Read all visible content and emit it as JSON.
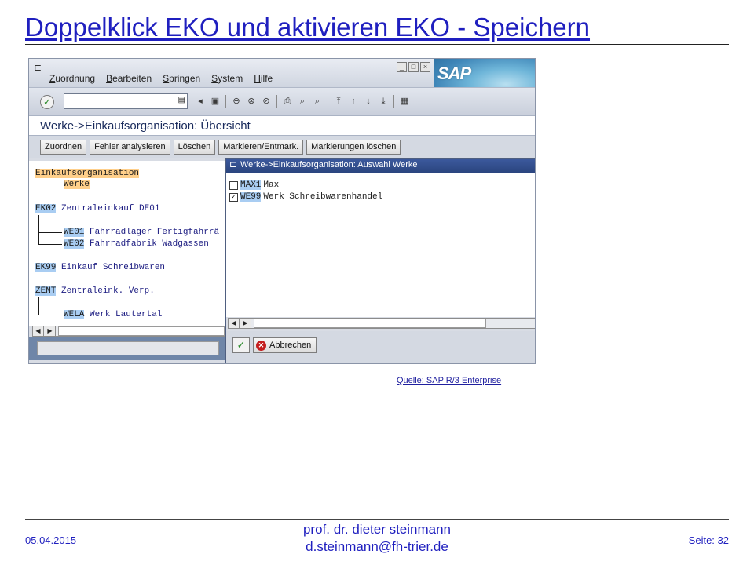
{
  "slide": {
    "title": "Doppelklick EKO und aktivieren EKO - Speichern",
    "source": "Quelle: SAP R/3 Enterprise",
    "footer": {
      "date": "05.04.2015",
      "author_line1": "prof. dr. dieter steinmann",
      "author_line2": "d.steinmann@fh-trier.de",
      "page": "Seite: 32"
    }
  },
  "sap": {
    "logo": "SAP",
    "menu": [
      {
        "first": "Z",
        "rest": "uordnung"
      },
      {
        "first": "B",
        "rest": "earbeiten"
      },
      {
        "first": "S",
        "rest": "pringen"
      },
      {
        "first": "S",
        "rest": "ystem"
      },
      {
        "first": "H",
        "rest": "ilfe"
      }
    ],
    "screen_title": "Werke->Einkaufsorganisation: Übersicht",
    "app_buttons": [
      "Zuordnen",
      "Fehler analysieren",
      "Löschen",
      "Markieren/Entmark.",
      "Markierungen löschen"
    ],
    "tree": {
      "header1": "Einkaufsorganisation",
      "header2": "Werke",
      "nodes": [
        {
          "code": "EK02",
          "text": "Zentraleinkauf DE01"
        },
        {
          "code": "WE01",
          "text": "Fahrradlager Fertigfahrrä"
        },
        {
          "code": "WE02",
          "text": "Fahrradfabrik Wadgassen"
        },
        {
          "code": "EK99",
          "text": "Einkauf Schreibwaren"
        },
        {
          "code": "ZENT",
          "text": "Zentraleink.  Verp."
        },
        {
          "code": "WELA",
          "text": "Werk Lautertal"
        }
      ]
    },
    "popup": {
      "title": "Werke->Einkaufsorganisation: Auswahl Werke",
      "rows": [
        {
          "code": "MAX1",
          "text": "Max",
          "checked": false
        },
        {
          "code": "WE99",
          "text": "Werk Schreibwarenhandel",
          "checked": true
        }
      ],
      "cancel_label": "Abbrechen"
    }
  }
}
